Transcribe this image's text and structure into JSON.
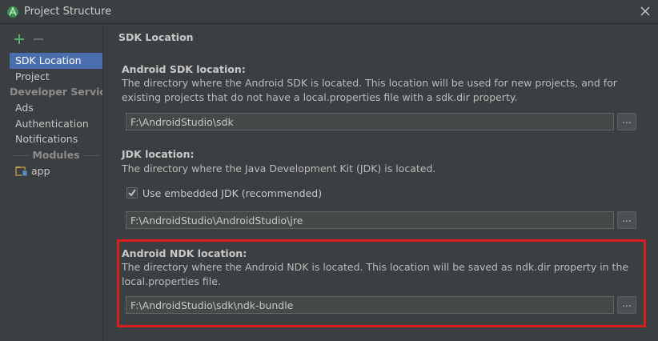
{
  "window": {
    "title": "Project Structure"
  },
  "sidebar": {
    "items": [
      {
        "label": "SDK Location",
        "selected": true
      },
      {
        "label": "Project"
      }
    ],
    "section_developer": "Developer Services",
    "developer_items": [
      {
        "label": "Ads"
      },
      {
        "label": "Authentication"
      },
      {
        "label": "Notifications"
      }
    ],
    "modules_header": "Modules",
    "modules": [
      {
        "label": "app"
      }
    ]
  },
  "content": {
    "page_title": "SDK Location",
    "android_sdk": {
      "label": "Android SDK location:",
      "description": "The directory where the Android SDK is located. This location will be used for new projects, and for existing projects that do not have a local.properties file with a sdk.dir property.",
      "path": "F:\\AndroidStudio\\sdk",
      "browse": "..."
    },
    "jdk": {
      "label": "JDK location:",
      "description": "The directory where the Java Development Kit (JDK) is located.",
      "checkbox_label": "Use embedded JDK (recommended)",
      "checkbox_checked": true,
      "path": "F:\\AndroidStudio\\AndroidStudio\\jre",
      "browse": "..."
    },
    "android_ndk": {
      "label": "Android NDK location:",
      "description": "The directory where the Android NDK is located. This location will be saved as ndk.dir property in the local.properties file.",
      "path": "F:\\AndroidStudio\\sdk\\ndk-bundle",
      "browse": "..."
    }
  },
  "colors": {
    "background": "#3c3f41",
    "selection": "#4b6eaf",
    "highlight_border": "#d91c1c",
    "add_icon": "#59a869"
  }
}
